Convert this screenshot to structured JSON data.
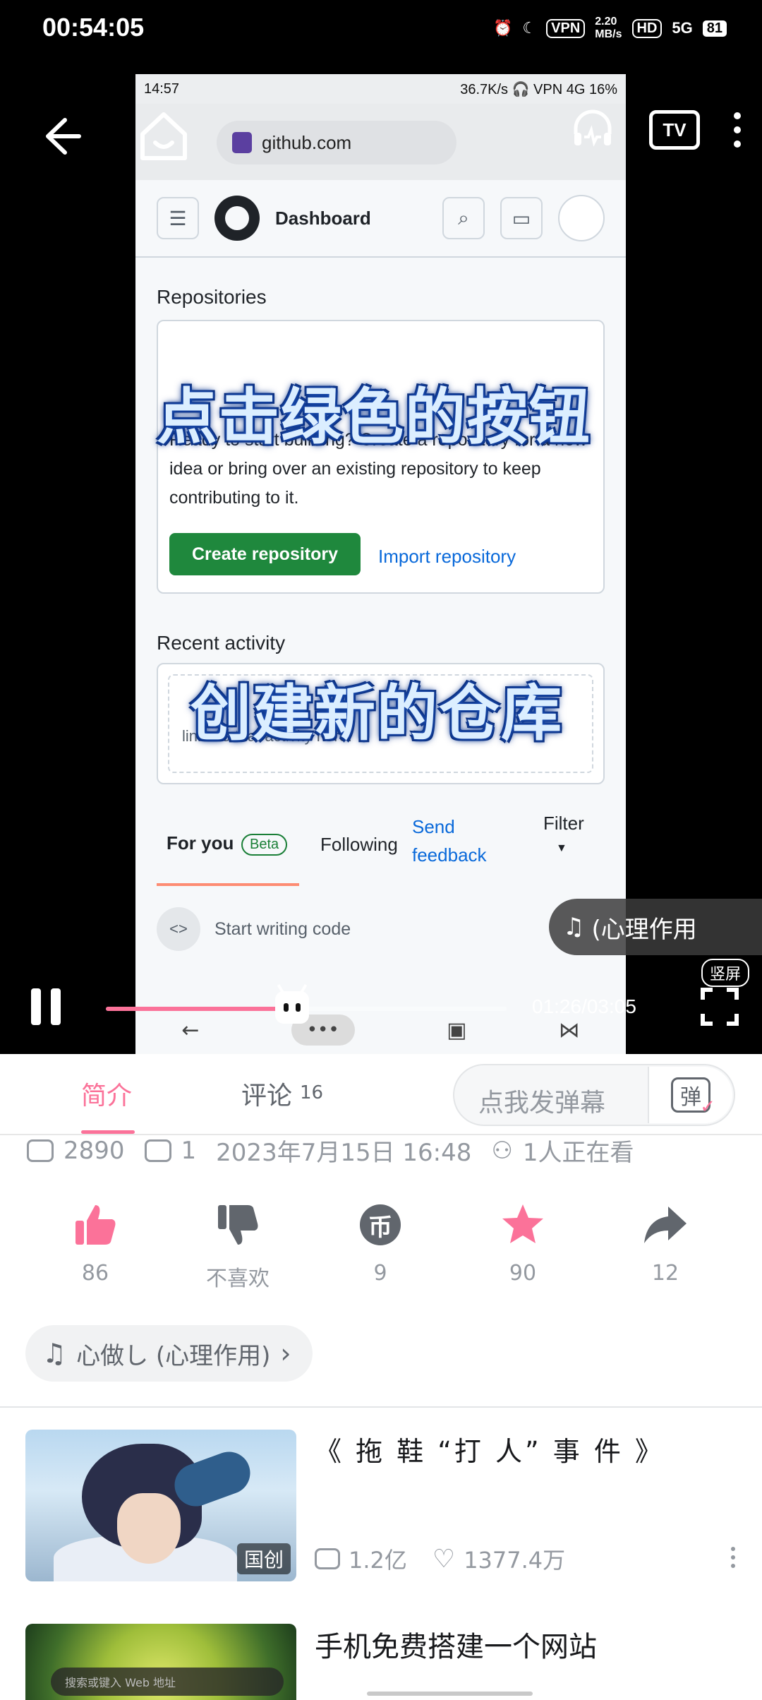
{
  "status_bar": {
    "time": "00:54:05",
    "vpn": "VPN",
    "speed": "2.20",
    "speed_unit": "MB/s",
    "hd": "HD",
    "network": "5G",
    "battery": "81"
  },
  "player": {
    "current_time": "01:26",
    "duration": "03:05",
    "time_display": "01:26/03:05",
    "progress_fraction": 0.465,
    "vertical_screen_label": "竖屏",
    "bgm_overlay": "(心理作用",
    "subtitle_1": "点击绿色的按钮",
    "subtitle_2": "创建新的仓库",
    "tv_label": "TV"
  },
  "recorded_screen": {
    "status_time": "14:57",
    "status_right": "36.7K/s 🎧 VPN 4G 16%",
    "url": "github.com",
    "header_title": "Dashboard",
    "repositories_heading": "Repositories",
    "repositories_text": "Ready to start building? Create a repository for a new idea or bring over an existing repository to keep contributing to it.",
    "create_button": "Create repository",
    "import_link": "Import repository",
    "recent_activity_heading": "Recent activity",
    "recent_activity_text": "links to that activity here.",
    "tabs": {
      "for_you": "For you",
      "beta": "Beta",
      "following": "Following",
      "send_feedback": "Send feedback",
      "filter": "Filter"
    },
    "start_writing": "Start writing code"
  },
  "tabbar": {
    "intro": "简介",
    "comments": "评论",
    "comments_count": "16",
    "danmaku_placeholder": "点我发弹幕",
    "danmaku_icon_text": "弹"
  },
  "info": {
    "views": "2890",
    "danmaku_count": "1",
    "publish_time": "2023年7月15日 16:48",
    "watching": "1人正在看"
  },
  "actions": [
    {
      "label": "86",
      "icon": "thumbs-up-icon"
    },
    {
      "label": "不喜欢",
      "icon": "thumbs-down-icon"
    },
    {
      "label": "9",
      "icon": "coin-icon"
    },
    {
      "label": "90",
      "icon": "star-icon"
    },
    {
      "label": "12",
      "icon": "share-icon"
    }
  ],
  "bgm": {
    "label": "心做し (心理作用)"
  },
  "related": [
    {
      "title": "《 拖 鞋 “打 人” 事 件 》",
      "badge": "国创",
      "views": "1.2亿",
      "likes": "1377.4万"
    },
    {
      "title": "手机免费搭建一个网站",
      "thumb_search": "搜索或键入 Web 地址"
    }
  ],
  "colors": {
    "accent_pink": "#fb7299",
    "github_green": "#1f883d",
    "github_link": "#0969da"
  }
}
